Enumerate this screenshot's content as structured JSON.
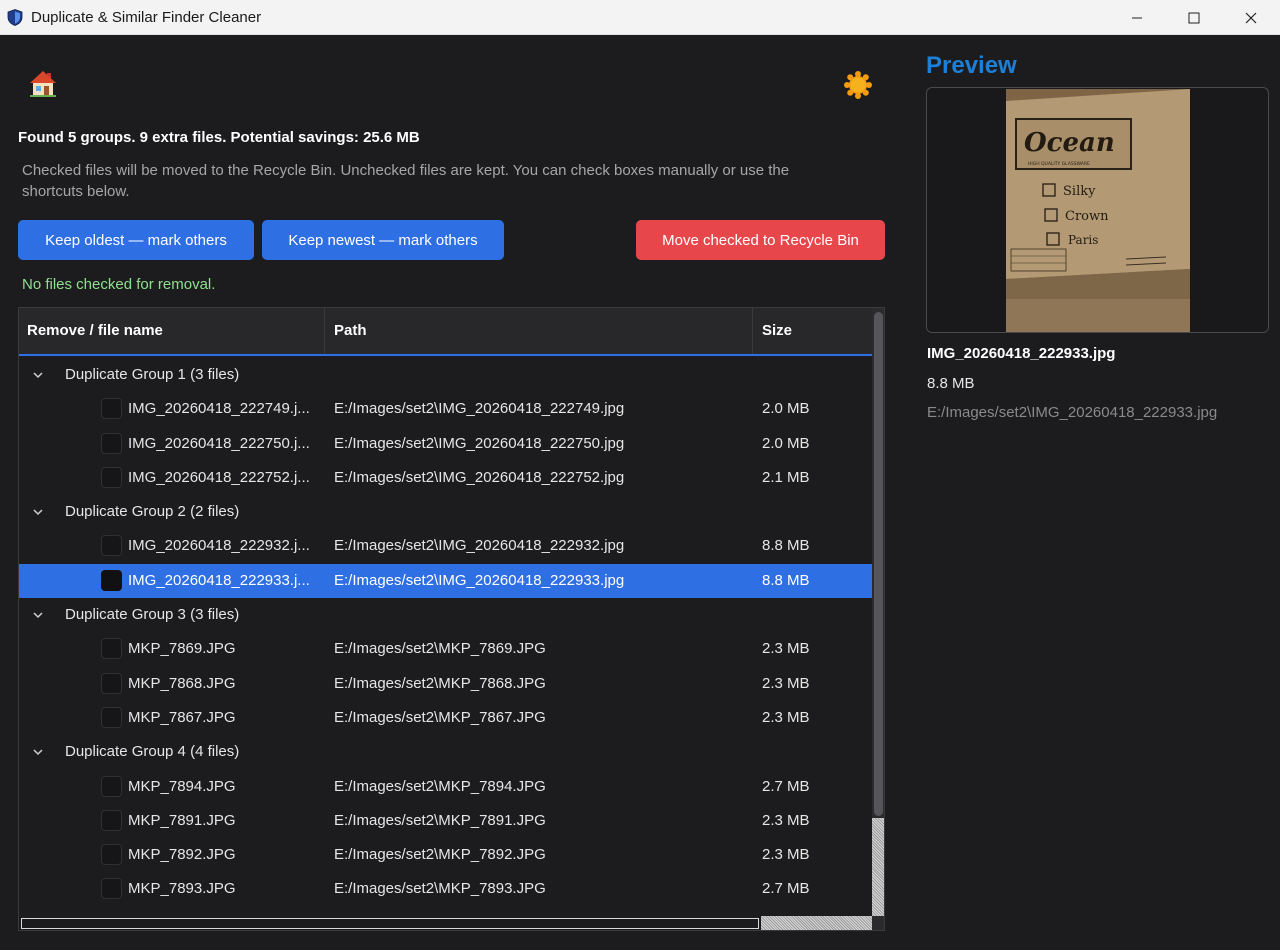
{
  "window": {
    "title": "Duplicate & Similar Finder Cleaner",
    "controls": [
      "minimize",
      "maximize",
      "close"
    ]
  },
  "header": {
    "home_icon": "home-icon",
    "theme_icon": "sun-icon"
  },
  "summary": {
    "text": "Found 5 groups. 9 extra files. Potential savings: 25.6 MB",
    "help": "Checked files will be moved to the Recycle Bin. Unchecked files are kept. You can check boxes manually or use the shortcuts below."
  },
  "actions": {
    "keep_oldest": "Keep oldest — mark others",
    "keep_newest": "Keep newest — mark others",
    "move_checked": "Move checked to Recycle Bin",
    "move_color": "#e7474a",
    "primary_color": "#2f6fe4"
  },
  "status": {
    "text": "No files checked for removal.",
    "color": "#8ee08e"
  },
  "table": {
    "columns": {
      "name": "Remove / file name",
      "path": "Path",
      "size": "Size"
    },
    "groups": [
      {
        "label": "Duplicate Group 1 (3 files)",
        "files": [
          {
            "name": "IMG_20260418_222749.j...",
            "path": "E:/Images/set2\\IMG_20260418_222749.jpg",
            "size": "2.0 MB",
            "checked": false
          },
          {
            "name": "IMG_20260418_222750.j...",
            "path": "E:/Images/set2\\IMG_20260418_222750.jpg",
            "size": "2.0 MB",
            "checked": false
          },
          {
            "name": "IMG_20260418_222752.j...",
            "path": "E:/Images/set2\\IMG_20260418_222752.jpg",
            "size": "2.1 MB",
            "checked": false
          }
        ]
      },
      {
        "label": "Duplicate Group 2 (2 files)",
        "files": [
          {
            "name": "IMG_20260418_222932.j...",
            "path": "E:/Images/set2\\IMG_20260418_222932.jpg",
            "size": "8.8 MB",
            "checked": false
          },
          {
            "name": "IMG_20260418_222933.j...",
            "path": "E:/Images/set2\\IMG_20260418_222933.jpg",
            "size": "8.8 MB",
            "checked": false,
            "selected": true
          }
        ]
      },
      {
        "label": "Duplicate Group 3 (3 files)",
        "files": [
          {
            "name": "MKP_7869.JPG",
            "path": "E:/Images/set2\\MKP_7869.JPG",
            "size": "2.3 MB",
            "checked": false
          },
          {
            "name": "MKP_7868.JPG",
            "path": "E:/Images/set2\\MKP_7868.JPG",
            "size": "2.3 MB",
            "checked": false
          },
          {
            "name": "MKP_7867.JPG",
            "path": "E:/Images/set2\\MKP_7867.JPG",
            "size": "2.3 MB",
            "checked": false
          }
        ]
      },
      {
        "label": "Duplicate Group 4 (4 files)",
        "files": [
          {
            "name": "MKP_7894.JPG",
            "path": "E:/Images/set2\\MKP_7894.JPG",
            "size": "2.7 MB",
            "checked": false
          },
          {
            "name": "MKP_7891.JPG",
            "path": "E:/Images/set2\\MKP_7891.JPG",
            "size": "2.3 MB",
            "checked": false
          },
          {
            "name": "MKP_7892.JPG",
            "path": "E:/Images/set2\\MKP_7892.JPG",
            "size": "2.3 MB",
            "checked": false
          },
          {
            "name": "MKP_7893.JPG",
            "path": "E:/Images/set2\\MKP_7893.JPG",
            "size": "2.7 MB",
            "checked": false
          }
        ]
      }
    ]
  },
  "preview": {
    "title": "Preview",
    "title_color": "#1e7fd6",
    "filename": "IMG_20260418_222933.jpg",
    "size": "8.8 MB",
    "path": "E:/Images/set2\\IMG_20260418_222933.jpg",
    "image_text": {
      "brand": "Ocean",
      "tagline": "HIGH QUALITY GLASSWARE",
      "options": [
        "Silky",
        "Crown",
        "Paris"
      ]
    }
  }
}
